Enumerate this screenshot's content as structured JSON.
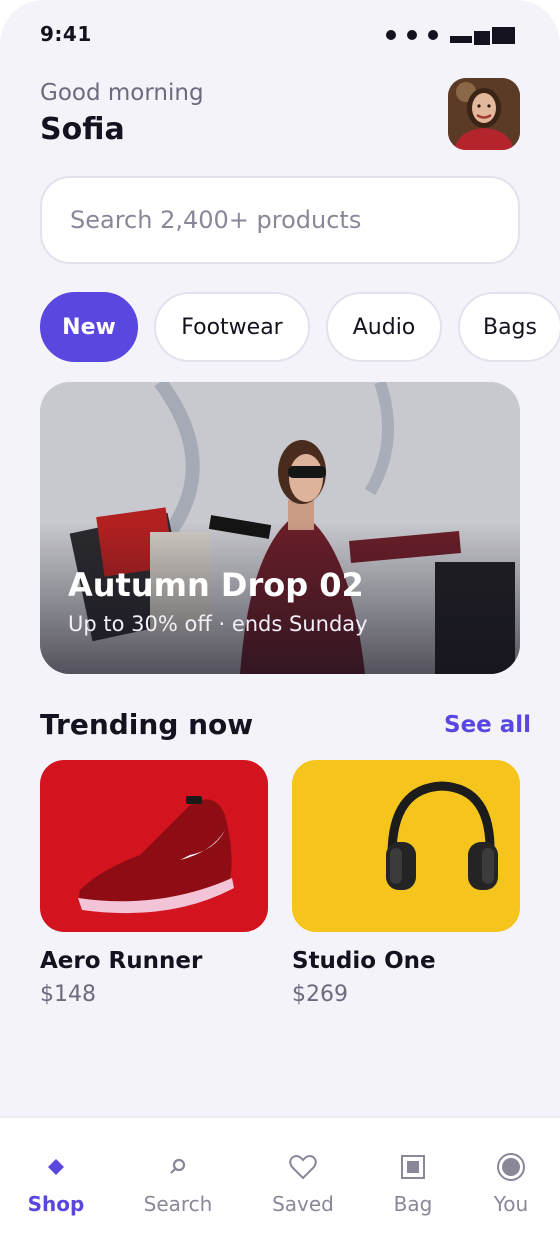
{
  "status_bar": {
    "time": "9:41"
  },
  "header": {
    "greeting": "Good morning",
    "user_name": "Sofia"
  },
  "search": {
    "placeholder": "Search 2,400+ products"
  },
  "chips": [
    {
      "label": "New",
      "active": true
    },
    {
      "label": "Footwear",
      "active": false
    },
    {
      "label": "Audio",
      "active": false
    },
    {
      "label": "Bags",
      "active": false
    }
  ],
  "banner": {
    "title": "Autumn Drop 02",
    "subtitle": "Up to 30% off · ends Sunday"
  },
  "trending": {
    "title": "Trending now",
    "see_all": "See all",
    "products": [
      {
        "name": "Aero Runner",
        "price": "$148",
        "image_icon": "red-sneaker"
      },
      {
        "name": "Studio One",
        "price": "$269",
        "image_icon": "headphones"
      }
    ]
  },
  "tabbar": {
    "tabs": [
      {
        "label": "Shop",
        "icon": "diamond-icon",
        "active": true
      },
      {
        "label": "Search",
        "icon": "search-icon",
        "active": false
      },
      {
        "label": "Saved",
        "icon": "heart-icon",
        "active": false
      },
      {
        "label": "Bag",
        "icon": "bag-icon",
        "active": false
      },
      {
        "label": "You",
        "icon": "profile-icon",
        "active": false
      }
    ]
  },
  "colors": {
    "accent": "#5a47e0",
    "background": "#f4f3f9",
    "text": "#14121f",
    "muted": "#6d6a7d"
  }
}
